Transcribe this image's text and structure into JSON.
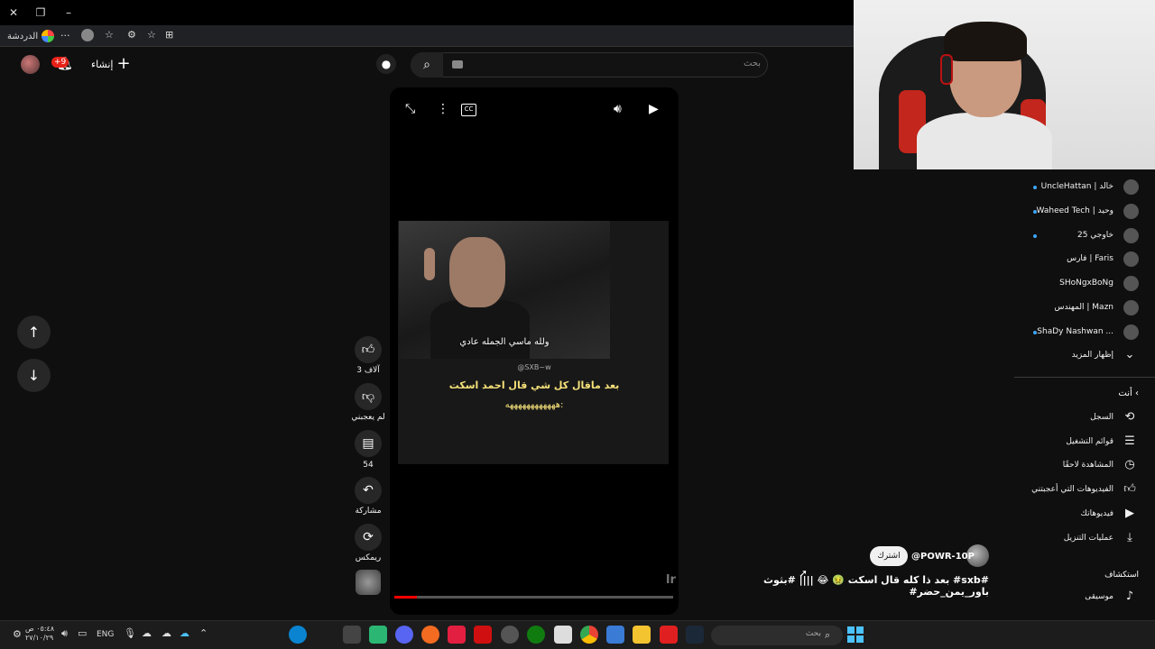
{
  "browser": {
    "workspace_label": "الدردشة",
    "close_glyph": "✕",
    "restore_glyph": "❐",
    "minimize_glyph": "–",
    "more_glyph": "···"
  },
  "header": {
    "notifications_badge": "+9",
    "create_label": "إنشاء",
    "search_placeholder": "بحث"
  },
  "short": {
    "thumbnail_caption": "ولله ماسي الجمله عادي",
    "handle": "@SXB~w",
    "caption_line1": "بعد ماقال كل شي قال احمد اسكت",
    "caption_line2": "ههههههههههههه:",
    "progress": 0.08,
    "like_count": "3 آلاف",
    "dislike_label": "لم يعجبني",
    "comments_count": "54",
    "share_label": "مشاركة",
    "remix_label": "ريمكس"
  },
  "channel": {
    "name": "@POWR-10P",
    "subscribe_label": "اشترك",
    "video_title": "بعد ذا كله  قال اسكت 🤢 😂 |||| #بثوث #sxb# #باور_يمن_حضر"
  },
  "sidebar": {
    "subscriptions": [
      {
        "label": "UncleHattan | خالد",
        "dot": true
      },
      {
        "label": "Waheed Tech | وحيد",
        "dot": true
      },
      {
        "label": "خاوجي 25",
        "dot": true
      },
      {
        "label": "فارس | Faris",
        "dot": false
      },
      {
        "label": "SHoNgxBoNg",
        "dot": false
      },
      {
        "label": "المهندس | Mazn",
        "dot": false
      },
      {
        "label": "ShaDy Nashwan ...",
        "dot": true
      }
    ],
    "show_more": "إظهار المزيد",
    "you_heading": "أنت ‹",
    "you_items": [
      {
        "label": "السجل",
        "icon": "history-icon"
      },
      {
        "label": "قوائم التشغيل",
        "icon": "playlist-icon"
      },
      {
        "label": "المشاهدة لاحقًا",
        "icon": "clock-icon"
      },
      {
        "label": "الفيديوهات التي أعجبتني",
        "icon": "like-icon"
      },
      {
        "label": "فيديوهاتك",
        "icon": "video-icon"
      },
      {
        "label": "عمليات التنزيل",
        "icon": "download-icon"
      }
    ],
    "explore_heading": "استكشاف",
    "music_label": "موسيقى"
  },
  "taskbar": {
    "time": "٠٥:٤٨ ص",
    "date": "٢٧/١٠/٢٩",
    "language": "ENG",
    "search_placeholder": "بحث"
  },
  "colors": {
    "background": "#0f0f0f",
    "accent_red": "#ff0000",
    "caption_yellow": "#f6e27a",
    "taskbar": "#1c1c1c"
  }
}
